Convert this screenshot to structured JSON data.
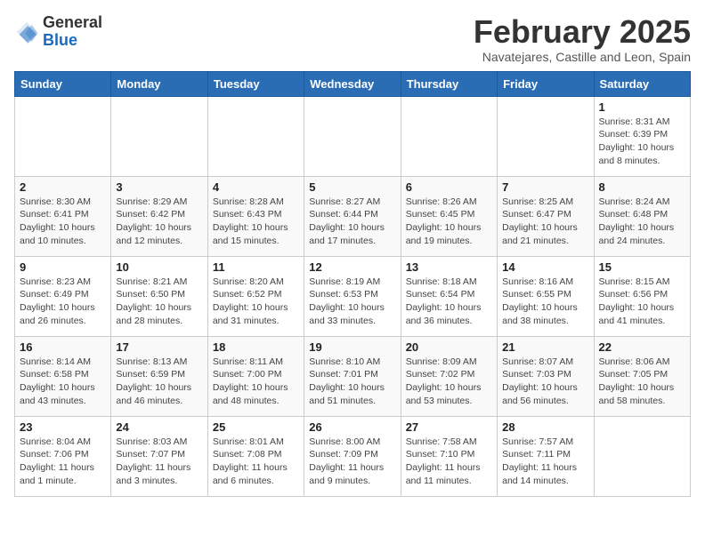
{
  "header": {
    "logo_general": "General",
    "logo_blue": "Blue",
    "title": "February 2025",
    "subtitle": "Navatejares, Castille and Leon, Spain"
  },
  "weekdays": [
    "Sunday",
    "Monday",
    "Tuesday",
    "Wednesday",
    "Thursday",
    "Friday",
    "Saturday"
  ],
  "weeks": [
    [
      {
        "day": "",
        "info": ""
      },
      {
        "day": "",
        "info": ""
      },
      {
        "day": "",
        "info": ""
      },
      {
        "day": "",
        "info": ""
      },
      {
        "day": "",
        "info": ""
      },
      {
        "day": "",
        "info": ""
      },
      {
        "day": "1",
        "info": "Sunrise: 8:31 AM\nSunset: 6:39 PM\nDaylight: 10 hours and 8 minutes."
      }
    ],
    [
      {
        "day": "2",
        "info": "Sunrise: 8:30 AM\nSunset: 6:41 PM\nDaylight: 10 hours and 10 minutes."
      },
      {
        "day": "3",
        "info": "Sunrise: 8:29 AM\nSunset: 6:42 PM\nDaylight: 10 hours and 12 minutes."
      },
      {
        "day": "4",
        "info": "Sunrise: 8:28 AM\nSunset: 6:43 PM\nDaylight: 10 hours and 15 minutes."
      },
      {
        "day": "5",
        "info": "Sunrise: 8:27 AM\nSunset: 6:44 PM\nDaylight: 10 hours and 17 minutes."
      },
      {
        "day": "6",
        "info": "Sunrise: 8:26 AM\nSunset: 6:45 PM\nDaylight: 10 hours and 19 minutes."
      },
      {
        "day": "7",
        "info": "Sunrise: 8:25 AM\nSunset: 6:47 PM\nDaylight: 10 hours and 21 minutes."
      },
      {
        "day": "8",
        "info": "Sunrise: 8:24 AM\nSunset: 6:48 PM\nDaylight: 10 hours and 24 minutes."
      }
    ],
    [
      {
        "day": "9",
        "info": "Sunrise: 8:23 AM\nSunset: 6:49 PM\nDaylight: 10 hours and 26 minutes."
      },
      {
        "day": "10",
        "info": "Sunrise: 8:21 AM\nSunset: 6:50 PM\nDaylight: 10 hours and 28 minutes."
      },
      {
        "day": "11",
        "info": "Sunrise: 8:20 AM\nSunset: 6:52 PM\nDaylight: 10 hours and 31 minutes."
      },
      {
        "day": "12",
        "info": "Sunrise: 8:19 AM\nSunset: 6:53 PM\nDaylight: 10 hours and 33 minutes."
      },
      {
        "day": "13",
        "info": "Sunrise: 8:18 AM\nSunset: 6:54 PM\nDaylight: 10 hours and 36 minutes."
      },
      {
        "day": "14",
        "info": "Sunrise: 8:16 AM\nSunset: 6:55 PM\nDaylight: 10 hours and 38 minutes."
      },
      {
        "day": "15",
        "info": "Sunrise: 8:15 AM\nSunset: 6:56 PM\nDaylight: 10 hours and 41 minutes."
      }
    ],
    [
      {
        "day": "16",
        "info": "Sunrise: 8:14 AM\nSunset: 6:58 PM\nDaylight: 10 hours and 43 minutes."
      },
      {
        "day": "17",
        "info": "Sunrise: 8:13 AM\nSunset: 6:59 PM\nDaylight: 10 hours and 46 minutes."
      },
      {
        "day": "18",
        "info": "Sunrise: 8:11 AM\nSunset: 7:00 PM\nDaylight: 10 hours and 48 minutes."
      },
      {
        "day": "19",
        "info": "Sunrise: 8:10 AM\nSunset: 7:01 PM\nDaylight: 10 hours and 51 minutes."
      },
      {
        "day": "20",
        "info": "Sunrise: 8:09 AM\nSunset: 7:02 PM\nDaylight: 10 hours and 53 minutes."
      },
      {
        "day": "21",
        "info": "Sunrise: 8:07 AM\nSunset: 7:03 PM\nDaylight: 10 hours and 56 minutes."
      },
      {
        "day": "22",
        "info": "Sunrise: 8:06 AM\nSunset: 7:05 PM\nDaylight: 10 hours and 58 minutes."
      }
    ],
    [
      {
        "day": "23",
        "info": "Sunrise: 8:04 AM\nSunset: 7:06 PM\nDaylight: 11 hours and 1 minute."
      },
      {
        "day": "24",
        "info": "Sunrise: 8:03 AM\nSunset: 7:07 PM\nDaylight: 11 hours and 3 minutes."
      },
      {
        "day": "25",
        "info": "Sunrise: 8:01 AM\nSunset: 7:08 PM\nDaylight: 11 hours and 6 minutes."
      },
      {
        "day": "26",
        "info": "Sunrise: 8:00 AM\nSunset: 7:09 PM\nDaylight: 11 hours and 9 minutes."
      },
      {
        "day": "27",
        "info": "Sunrise: 7:58 AM\nSunset: 7:10 PM\nDaylight: 11 hours and 11 minutes."
      },
      {
        "day": "28",
        "info": "Sunrise: 7:57 AM\nSunset: 7:11 PM\nDaylight: 11 hours and 14 minutes."
      },
      {
        "day": "",
        "info": ""
      }
    ]
  ]
}
